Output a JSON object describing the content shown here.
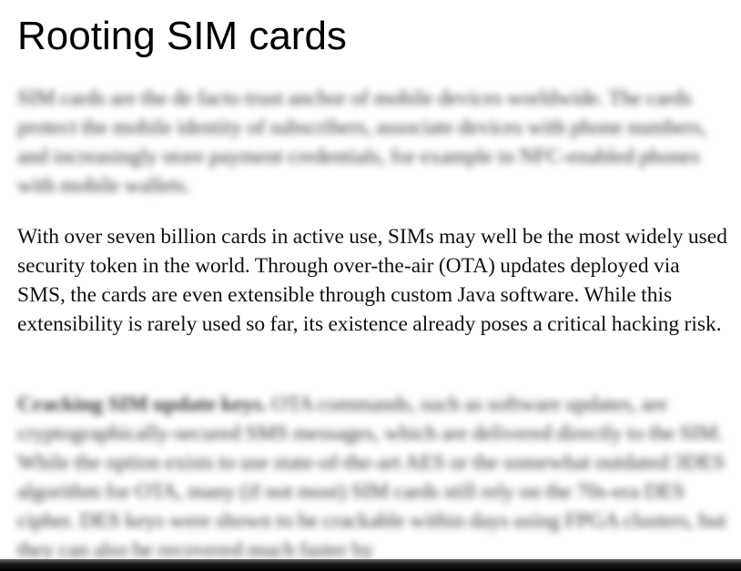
{
  "document": {
    "title": "Rooting SIM cards",
    "paragraph_1": "SIM cards are the de facto trust anchor of mobile devices worldwide. The cards protect the mobile identity of subscribers, associate devices with phone numbers, and increasingly store payment credentials, for example in NFC-enabled phones with mobile wallets.",
    "paragraph_2": "With over seven billion cards in active use, SIMs may well be the most widely used security token in the world. Through over-the-air (OTA) updates deployed via SMS, the cards are even extensible through custom Java software. While this extensibility is rarely used so far, its existence already poses a critical hacking risk.",
    "paragraph_3_lead": "Cracking SIM update keys.",
    "paragraph_3_body": " OTA commands, such as software updates, are cryptographically-secured SMS messages, which are delivered directly to the SIM. While the option exists to use state-of-the-art AES or the somewhat outdated 3DES algorithm for OTA, many (if not most) SIM cards still rely on the 70s-era DES cipher. DES keys were shown to be crackable within days using FPGA clusters, but they can also be recovered much faster by"
  }
}
